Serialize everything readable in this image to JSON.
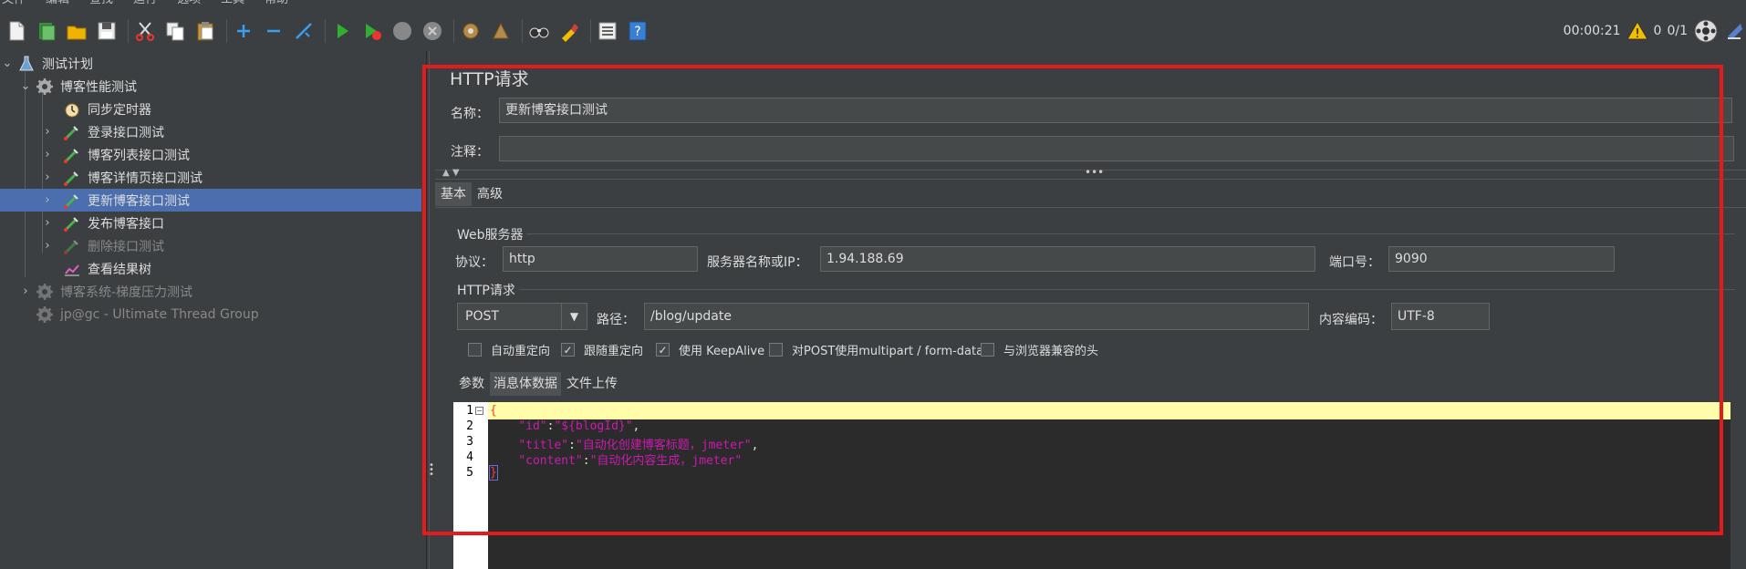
{
  "menu": [
    "文件",
    "编辑",
    "查找",
    "运行",
    "选项",
    "工具",
    "帮助"
  ],
  "toolbar": {
    "icons": [
      "new-icon",
      "templates-icon",
      "open-icon",
      "save-icon",
      "cut-icon",
      "copy-icon",
      "paste-icon",
      "expand-icon",
      "collapse-icon",
      "toggle-icon",
      "start-icon",
      "start-no-pause-icon",
      "stop-icon",
      "shutdown-icon",
      "clear-icon",
      "clear-all-icon",
      "search-icon",
      "reset-search-icon",
      "function-helper-icon",
      "help-icon"
    ],
    "timer": "00:00:21",
    "warning_count": "0",
    "threads": "0/1"
  },
  "tree": [
    {
      "label": "测试计划",
      "level": 0,
      "chevron": "⌄",
      "icon": "flask-icon",
      "state": "normal"
    },
    {
      "label": "博客性能测试",
      "level": 1,
      "chevron": "⌄",
      "icon": "gear-icon",
      "state": "normal"
    },
    {
      "label": "同步定时器",
      "level": 2,
      "chevron": "",
      "icon": "timer-icon",
      "state": "normal"
    },
    {
      "label": "登录接口测试",
      "level": 2,
      "chevron": "›",
      "icon": "sampler-icon",
      "state": "normal"
    },
    {
      "label": "博客列表接口测试",
      "level": 2,
      "chevron": "›",
      "icon": "sampler-icon",
      "state": "normal"
    },
    {
      "label": "博客详情页接口测试",
      "level": 2,
      "chevron": "›",
      "icon": "sampler-icon",
      "state": "normal"
    },
    {
      "label": "更新博客接口测试",
      "level": 2,
      "chevron": "›",
      "icon": "sampler-icon",
      "state": "selected"
    },
    {
      "label": "发布博客接口",
      "level": 2,
      "chevron": "›",
      "icon": "sampler-icon",
      "state": "normal"
    },
    {
      "label": "删除接口测试",
      "level": 2,
      "chevron": "›",
      "icon": "sampler-icon",
      "state": "disabled"
    },
    {
      "label": "查看结果树",
      "level": 2,
      "chevron": "",
      "icon": "chart-icon",
      "state": "normal"
    },
    {
      "label": "博客系统-梯度压力测试",
      "level": 1,
      "chevron": "›",
      "icon": "gear-icon",
      "state": "disabled"
    },
    {
      "label": "jp@gc - Ultimate Thread Group",
      "level": 1,
      "chevron": "",
      "icon": "gear-icon",
      "state": "disabled"
    }
  ],
  "panel": {
    "title": "HTTP请求",
    "name_label": "名称：",
    "name_value": "更新博客接口测试",
    "comment_label": "注释：",
    "comment_value": "",
    "tabs": [
      "基本",
      "高级"
    ],
    "web_server_title": "Web服务器",
    "protocol_label": "协议：",
    "protocol_value": "http",
    "server_label": "服务器名称或IP：",
    "server_value": "1.94.188.69",
    "port_label": "端口号：",
    "port_value": "9090",
    "http_request_title": "HTTP请求",
    "method_value": "POST",
    "path_label": "路径：",
    "path_value": "/blog/update",
    "encoding_label": "内容编码：",
    "encoding_value": "UTF-8",
    "checkboxes": [
      {
        "label": "自动重定向",
        "checked": false
      },
      {
        "label": "跟随重定向",
        "checked": true
      },
      {
        "label": "使用 KeepAlive",
        "checked": true
      },
      {
        "label": "对POST使用multipart / form-data",
        "checked": false
      },
      {
        "label": "与浏览器兼容的头",
        "checked": false
      }
    ],
    "body_tabs": [
      "参数",
      "消息体数据",
      "文件上传"
    ],
    "body_lines": [
      {
        "n": "1",
        "text": "{"
      },
      {
        "n": "2",
        "key": "\"id\"",
        "sep": ":",
        "val": "\"${blogId}\"",
        "end": ","
      },
      {
        "n": "3",
        "key": "\"title\"",
        "sep": ":",
        "val": "\"自动化创建博客标题，jmeter\"",
        "end": ","
      },
      {
        "n": "4",
        "key": "\"content\"",
        "sep": ":",
        "val": "\"自动化内容生成，jmeter\"",
        "end": ""
      },
      {
        "n": "5",
        "text": "}"
      }
    ]
  },
  "colors": {
    "background": "#3c3f41",
    "selected": "#4b6eaf",
    "highlight_box": "#e31b1b",
    "json_key": "#cc1ab0"
  }
}
